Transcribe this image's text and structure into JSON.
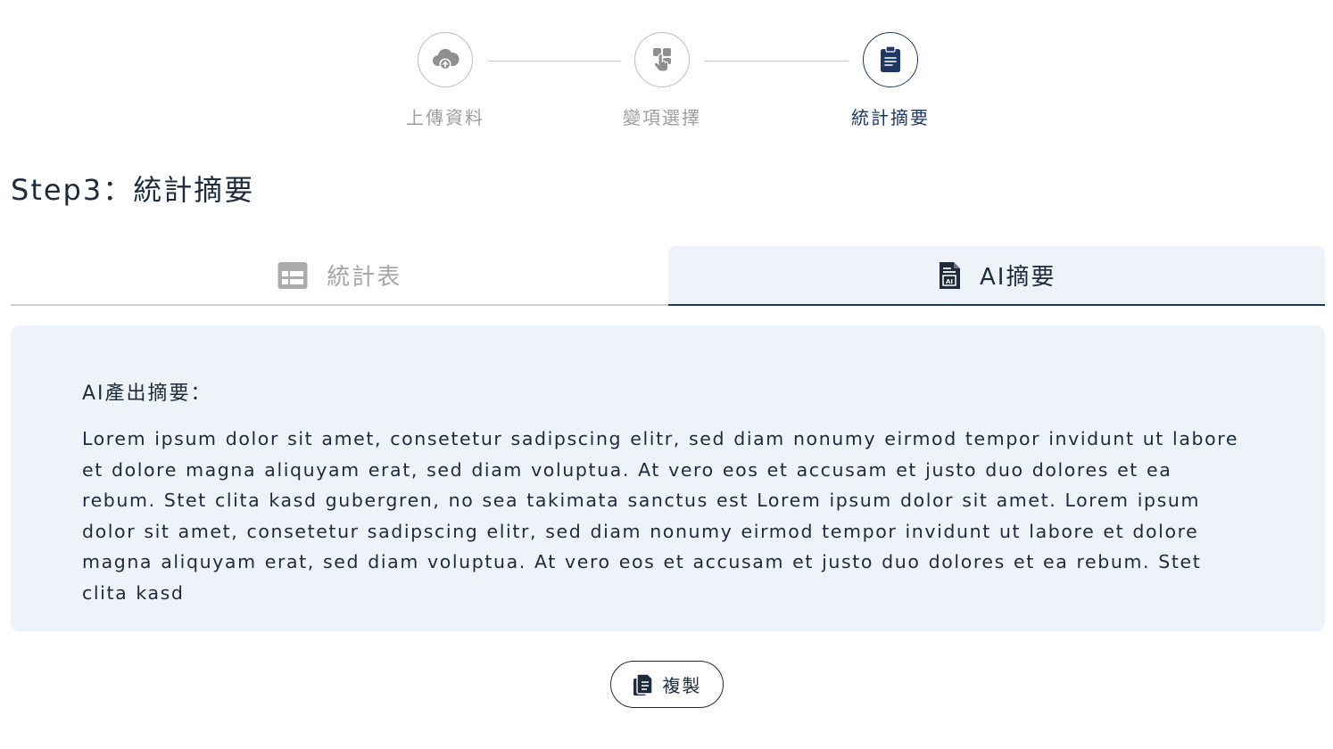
{
  "stepper": {
    "steps": [
      {
        "label": "上傳資料",
        "icon": "cloud-upload-icon",
        "state": "done"
      },
      {
        "label": "變項選擇",
        "icon": "touch-select-icon",
        "state": "done"
      },
      {
        "label": "統計摘要",
        "icon": "clipboard-icon",
        "state": "active"
      }
    ]
  },
  "page": {
    "title": "Step3：統計摘要"
  },
  "tabs": [
    {
      "label": "統計表",
      "icon": "table-icon",
      "active": false
    },
    {
      "label": "AI摘要",
      "icon": "ai-document-icon",
      "active": true
    }
  ],
  "summary": {
    "heading": "AI產出摘要：",
    "body": "Lorem ipsum dolor sit amet, consetetur sadipscing elitr, sed diam nonumy eirmod tempor invidunt ut labore et dolore magna aliquyam erat, sed diam voluptua. At vero eos et accusam et justo duo dolores et ea rebum. Stet clita kasd gubergren, no sea takimata sanctus est Lorem ipsum dolor sit amet. Lorem ipsum dolor sit amet, consetetur sadipscing elitr, sed diam nonumy eirmod tempor invidunt ut labore et dolore magna aliquyam erat, sed diam voluptua. At vero eos et accusam et justo duo dolores et ea rebum. Stet clita kasd"
  },
  "actions": {
    "copy_label": "複製",
    "copy_icon": "copy-icon"
  },
  "colors": {
    "accent": "#1f3864",
    "inactive": "#9e9e9e",
    "panel_bg": "#eef2f9"
  }
}
